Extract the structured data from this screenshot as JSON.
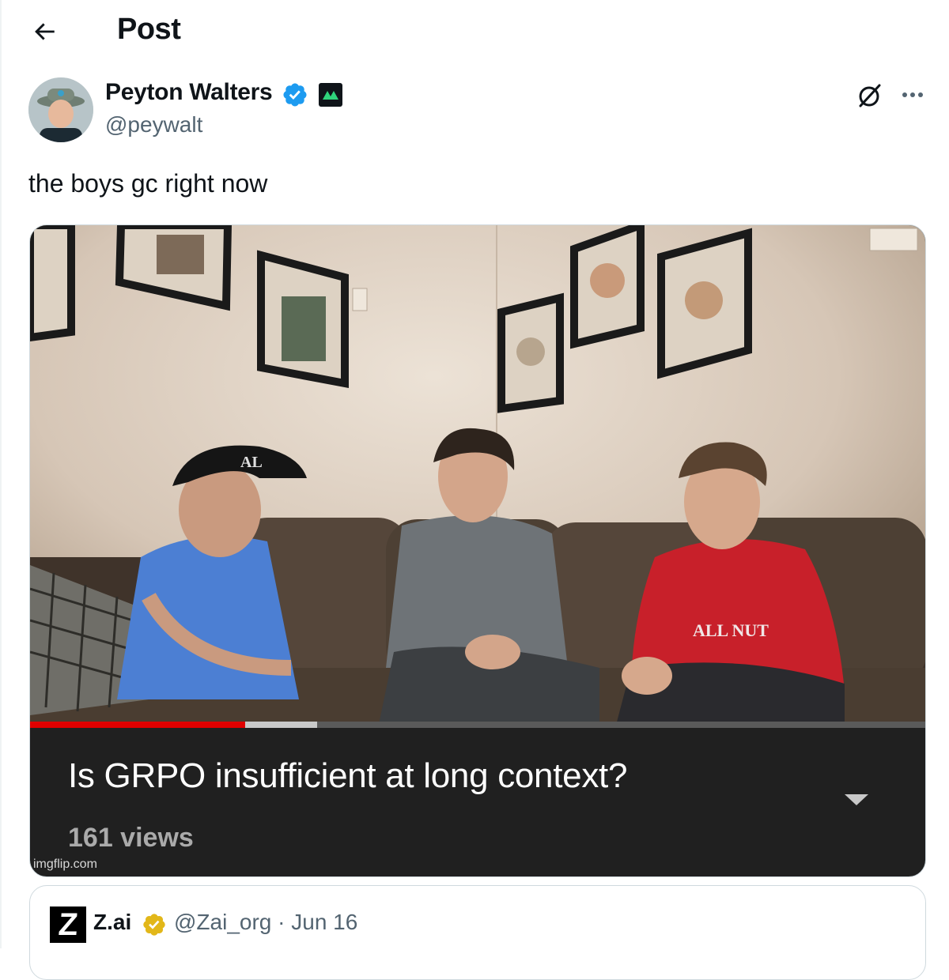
{
  "header": {
    "title": "Post"
  },
  "author": {
    "name": "Peyton Walters",
    "handle": "@peywalt"
  },
  "post": {
    "text": "the boys gc right now"
  },
  "media": {
    "video_title": "Is GRPO insufficient at long context?",
    "views": "161 views",
    "watermark": "imgflip.com",
    "cap_text_left": "AL",
    "shirt_text_right": "ALL NUT",
    "progress_played": 0.24,
    "progress_buffered": 0.32
  },
  "quoted": {
    "name": "Z.ai",
    "handle_date": "@Zai_org · Jun 16",
    "logo_letter": "Z"
  },
  "icons": {
    "back": "arrow-left-icon",
    "verified": "verified-badge-icon",
    "affiliate": "affiliate-badge-icon",
    "grok": "grok-icon",
    "more": "more-icon",
    "expand": "chevron-down-icon",
    "gold": "gold-verified-icon"
  },
  "colors": {
    "verified_blue": "#1d9bf0",
    "progress_red": "#e00000",
    "muted": "#536471",
    "gold": "#e2b719"
  }
}
